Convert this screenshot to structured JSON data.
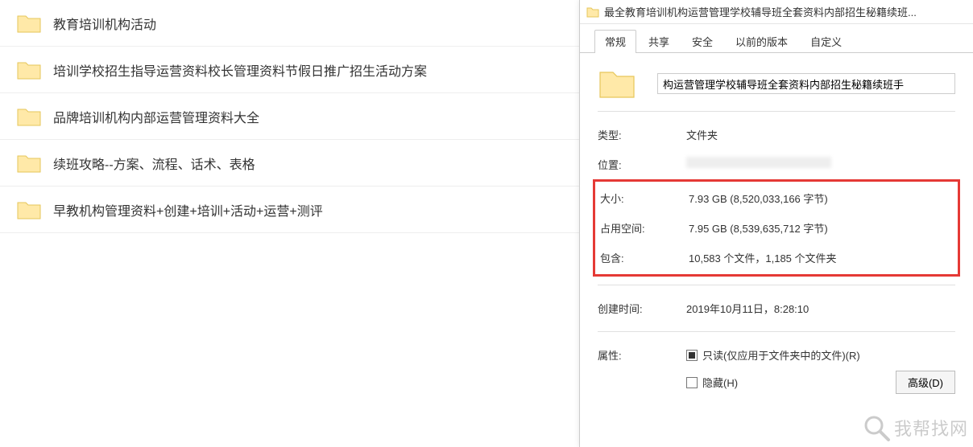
{
  "folders": [
    {
      "name": "教育培训机构活动"
    },
    {
      "name": "培训学校招生指导运营资料校长管理资料节假日推广招生活动方案"
    },
    {
      "name": "品牌培训机构内部运营管理资料大全"
    },
    {
      "name": "续班攻略--方案、流程、话术、表格"
    },
    {
      "name": "早教机构管理资料+创建+培训+活动+运营+测评"
    }
  ],
  "dialog": {
    "title": "最全教育培训机构运营管理学校辅导班全套资料内部招生秘籍续班...",
    "tabs": [
      {
        "label": "常规",
        "active": true
      },
      {
        "label": "共享",
        "active": false
      },
      {
        "label": "安全",
        "active": false
      },
      {
        "label": "以前的版本",
        "active": false
      },
      {
        "label": "自定义",
        "active": false
      }
    ],
    "name_value": "构运营管理学校辅导班全套资料内部招生秘籍续班手",
    "type_label": "类型:",
    "type_value": "文件夹",
    "location_label": "位置:",
    "size_label": "大小:",
    "size_value": "7.93 GB (8,520,033,166 字节)",
    "size_on_disk_label": "占用空间:",
    "size_on_disk_value": "7.95 GB (8,539,635,712 字节)",
    "contains_label": "包含:",
    "contains_value": "10,583 个文件，1,185 个文件夹",
    "created_label": "创建时间:",
    "created_value": "2019年10月11日，8:28:10",
    "attributes_label": "属性:",
    "readonly_label": "只读(仅应用于文件夹中的文件)(R)",
    "hidden_label": "隐藏(H)",
    "advanced_button": "高级(D)"
  },
  "watermark": {
    "text": "我帮找网",
    "url": "wobangzhao.com"
  }
}
